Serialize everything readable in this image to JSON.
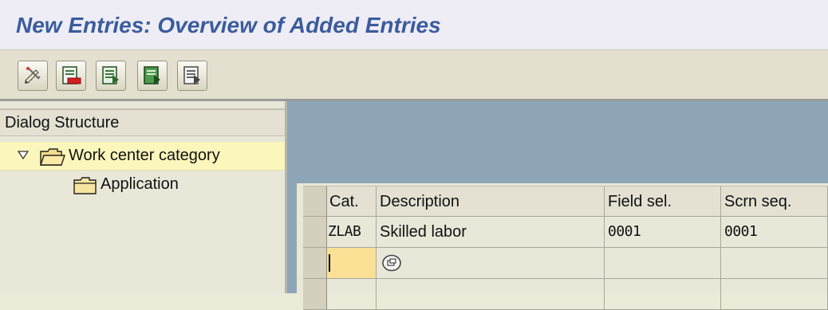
{
  "title": "New Entries: Overview of Added Entries",
  "toolbar": {
    "buttons": [
      {
        "icon": "change-display-icon"
      },
      {
        "icon": "delete-icon"
      },
      {
        "icon": "select-all-icon"
      },
      {
        "icon": "select-block-icon"
      },
      {
        "icon": "deselect-all-icon"
      }
    ]
  },
  "dialog": {
    "header": "Dialog Structure",
    "items": [
      {
        "label": "Work center category",
        "expanded": true,
        "selected": true
      },
      {
        "label": "Application",
        "expanded": false,
        "selected": false
      }
    ]
  },
  "table": {
    "columns": [
      "Cat.",
      "Description",
      "Field sel.",
      "Scrn seq."
    ],
    "rows": [
      {
        "cat": "ZLAB",
        "description": "Skilled labor",
        "field_sel": "0001",
        "scrn_seq": "0001"
      },
      {
        "cat": "",
        "description": "",
        "field_sel": "",
        "scrn_seq": ""
      }
    ]
  },
  "colors": {
    "title": "#3b5c9c",
    "tree_highlight": "#fbf6bb",
    "blue_area": "#8ea5b7",
    "input_focus": "#fbe196"
  }
}
